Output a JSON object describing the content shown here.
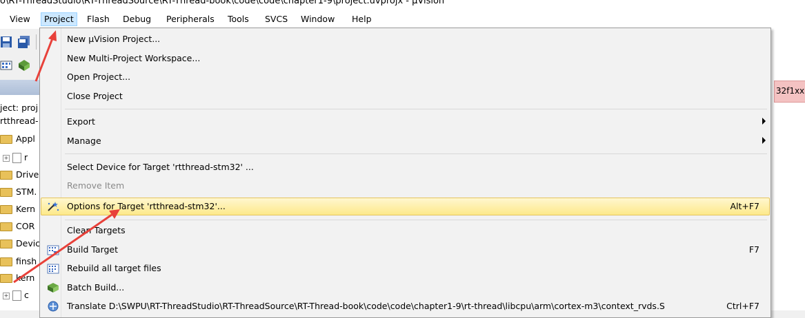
{
  "title": "o\\RT-ThreadStudio\\RT-ThreadSource\\RT-Thread-book\\code\\code\\chapter1-9\\project.uvprojx - µVision",
  "menubar": [
    {
      "label": "View"
    },
    {
      "label": "Project"
    },
    {
      "label": "Flash"
    },
    {
      "label": "Debug"
    },
    {
      "label": "Peripherals"
    },
    {
      "label": "Tools"
    },
    {
      "label": "SVCS"
    },
    {
      "label": "Window"
    },
    {
      "label": "Help"
    }
  ],
  "left_pane": {
    "project_label": "ject: proj",
    "target_label": "rtthread-",
    "rows": [
      {
        "text": "Appl",
        "kind": "folder"
      },
      {
        "text": "r",
        "kind": "file"
      },
      {
        "text": "Drive",
        "kind": "folder"
      },
      {
        "text": "STM.",
        "kind": "folder"
      },
      {
        "text": "Kern",
        "kind": "folder"
      },
      {
        "text": "COR",
        "kind": "folder"
      },
      {
        "text": "Devic",
        "kind": "folder"
      },
      {
        "text": "finsh",
        "kind": "folder"
      },
      {
        "text": "kern",
        "kind": "folder"
      },
      {
        "text": "c",
        "kind": "file"
      }
    ]
  },
  "right_tab": "32f1xx",
  "project_menu": {
    "items": [
      {
        "label": "New µVision Project...",
        "shortcut": "",
        "submenu": false,
        "disabled": false,
        "icon": ""
      },
      {
        "label": "New Multi-Project Workspace...",
        "shortcut": "",
        "submenu": false,
        "disabled": false,
        "icon": ""
      },
      {
        "label": "Open Project...",
        "shortcut": "",
        "submenu": false,
        "disabled": false,
        "icon": ""
      },
      {
        "label": "Close Project",
        "shortcut": "",
        "submenu": false,
        "disabled": false,
        "icon": ""
      },
      {
        "label": "Export",
        "shortcut": "",
        "submenu": true,
        "disabled": false,
        "icon": ""
      },
      {
        "label": "Manage",
        "shortcut": "",
        "submenu": true,
        "disabled": false,
        "icon": ""
      },
      {
        "label": "Select Device for Target 'rtthread-stm32' ...",
        "shortcut": "",
        "submenu": false,
        "disabled": false,
        "icon": ""
      },
      {
        "label": "Remove Item",
        "shortcut": "",
        "submenu": false,
        "disabled": true,
        "icon": ""
      },
      {
        "label": "Options for Target 'rtthread-stm32'...",
        "shortcut": "Alt+F7",
        "submenu": false,
        "disabled": false,
        "highlighted": true,
        "icon": "options-wand-icon"
      },
      {
        "label": "Clean Targets",
        "shortcut": "",
        "submenu": false,
        "disabled": false,
        "icon": ""
      },
      {
        "label": "Build Target",
        "shortcut": "F7",
        "submenu": false,
        "disabled": false,
        "icon": "build-icon"
      },
      {
        "label": "Rebuild all target files",
        "shortcut": "",
        "submenu": false,
        "disabled": false,
        "icon": "rebuild-icon"
      },
      {
        "label": "Batch Build...",
        "shortcut": "",
        "submenu": false,
        "disabled": false,
        "icon": "batch-build-icon"
      },
      {
        "label": "Translate D:\\SWPU\\RT-ThreadStudio\\RT-ThreadSource\\RT-Thread-book\\code\\code\\chapter1-9\\rt-thread\\libcpu\\arm\\cortex-m3\\context_rvds.S",
        "shortcut": "Ctrl+F7",
        "submenu": false,
        "disabled": false,
        "icon": "translate-icon"
      }
    ]
  },
  "colors": {
    "highlight": "#fde98a",
    "annotation_arrow": "#e8413a",
    "active_menu": "#cce8ff"
  }
}
